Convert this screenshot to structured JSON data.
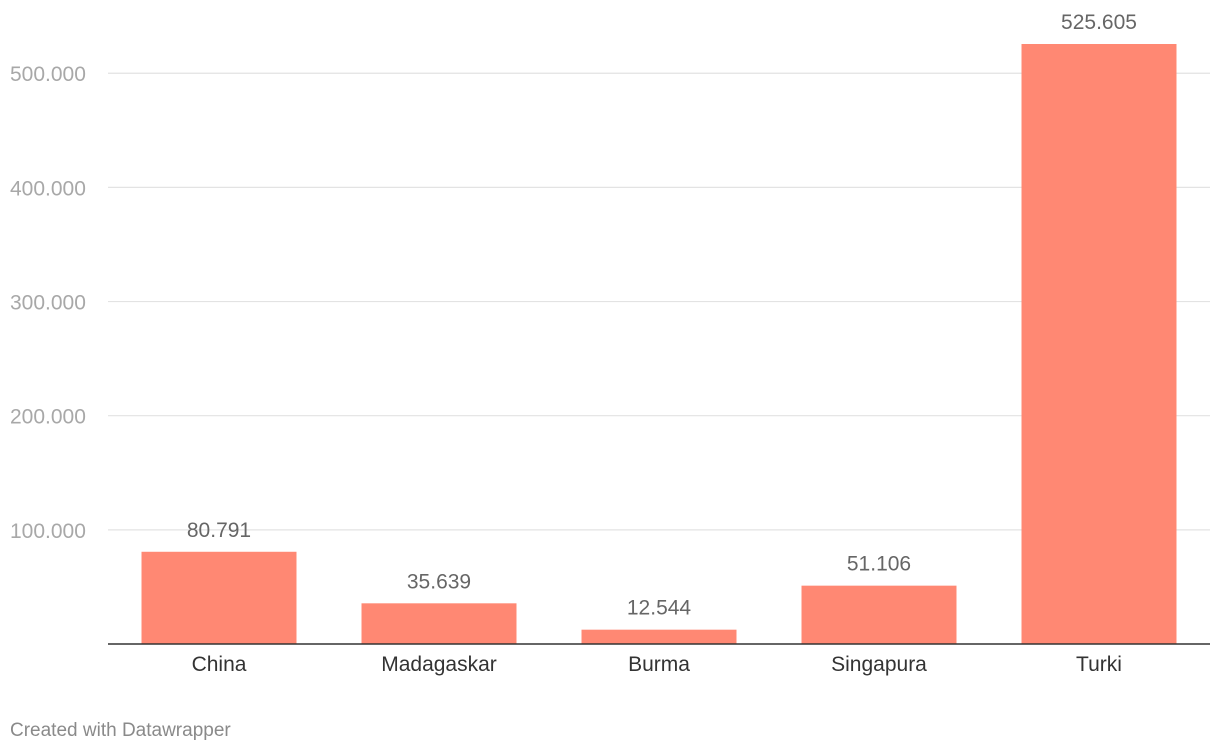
{
  "chart_data": {
    "type": "bar",
    "categories": [
      "China",
      "Madagaskar",
      "Burma",
      "Singapura",
      "Turki"
    ],
    "values": [
      80791,
      35639,
      12544,
      51106,
      525605
    ],
    "value_labels": [
      "80.791",
      "35.639",
      "12.544",
      "51.106",
      "525.605"
    ],
    "yticks": [
      100000,
      200000,
      300000,
      400000,
      500000
    ],
    "ytick_labels": [
      "100.000",
      "200.000",
      "300.000",
      "400.000",
      "500.000"
    ],
    "ylim": [
      0,
      525605
    ],
    "grid": true,
    "bar_color": "#ff8873"
  },
  "footer": {
    "credit": "Created with Datawrapper"
  }
}
